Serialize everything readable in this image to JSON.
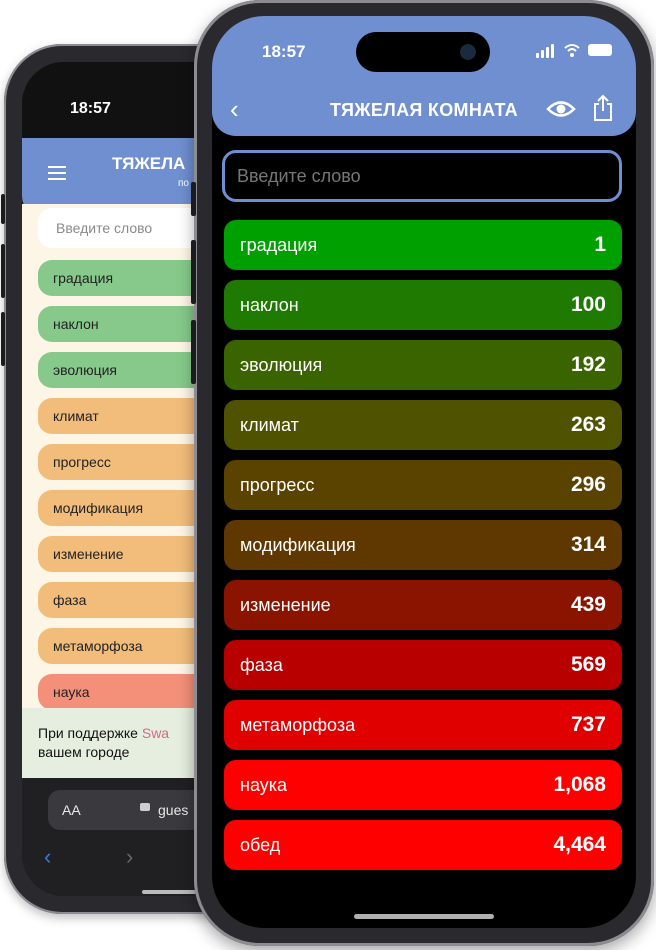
{
  "back_phone": {
    "status_time": "18:57",
    "header_title": "ТЯЖЕЛА",
    "header_sub": "по",
    "search_placeholder": "Введите слово",
    "items": [
      {
        "word": "градация",
        "color": "#86c98a"
      },
      {
        "word": "наклон",
        "color": "#86c98a"
      },
      {
        "word": "эволюция",
        "color": "#86c98a"
      },
      {
        "word": "климат",
        "color": "#f2bd7a"
      },
      {
        "word": "прогресс",
        "color": "#f2bd7a"
      },
      {
        "word": "модификация",
        "color": "#f2bd7a"
      },
      {
        "word": "изменение",
        "color": "#f2bd7a"
      },
      {
        "word": "фаза",
        "color": "#f2bd7a"
      },
      {
        "word": "метаморфоза",
        "color": "#f2bd7a"
      },
      {
        "word": "наука",
        "color": "#f4907a"
      }
    ],
    "footer_text_1": "При поддержке ",
    "footer_highlight": "Swa",
    "footer_text_2": "вашем городе",
    "url_aa": "AA",
    "url_text": "gues",
    "nav_back": "‹",
    "nav_forward": "›"
  },
  "front_phone": {
    "status_time": "18:57",
    "back_label": "‹",
    "title": "ТЯЖЕЛАЯ КОМНАТА",
    "search_placeholder": "Введите слово",
    "items": [
      {
        "word": "градация",
        "rank": "1",
        "color": "#00a000"
      },
      {
        "word": "наклон",
        "rank": "100",
        "color": "#1e7a00"
      },
      {
        "word": "эволюция",
        "rank": "192",
        "color": "#3a6400"
      },
      {
        "word": "климат",
        "rank": "263",
        "color": "#4f5200"
      },
      {
        "word": "прогресс",
        "rank": "296",
        "color": "#5a4200"
      },
      {
        "word": "модификация",
        "rank": "314",
        "color": "#5e3800"
      },
      {
        "word": "изменение",
        "rank": "439",
        "color": "#8a1400"
      },
      {
        "word": "фаза",
        "rank": "569",
        "color": "#b80000"
      },
      {
        "word": "метаморфоза",
        "rank": "737",
        "color": "#e00000"
      },
      {
        "word": "наука",
        "rank": "1,068",
        "color": "#ff0000"
      },
      {
        "word": "обед",
        "rank": "4,464",
        "color": "#ff0000"
      }
    ]
  },
  "colors": {
    "header_blue": "#6f8fd0",
    "back_content_bg": "#fdf5e6",
    "back_footer_bg": "#e6efdf",
    "nav_blue": "#3a7bd5"
  }
}
